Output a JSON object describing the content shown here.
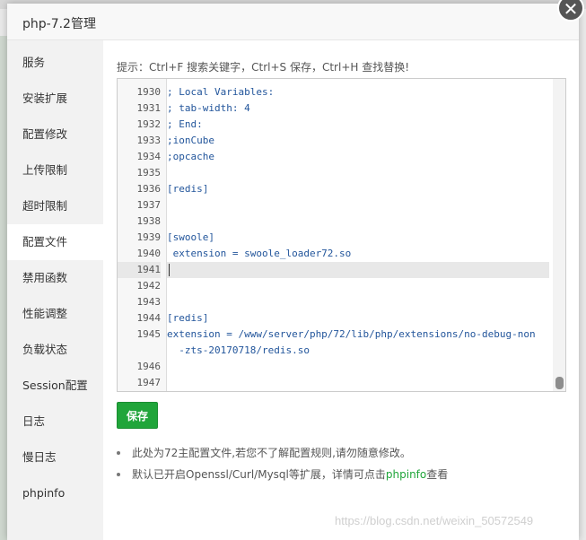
{
  "dialog": {
    "title": "php-7.2管理",
    "close_glyph": "✕"
  },
  "sidebar": {
    "items": [
      {
        "label": "服务"
      },
      {
        "label": "安装扩展"
      },
      {
        "label": "配置修改"
      },
      {
        "label": "上传限制"
      },
      {
        "label": "超时限制"
      },
      {
        "label": "配置文件"
      },
      {
        "label": "禁用函数"
      },
      {
        "label": "性能调整"
      },
      {
        "label": "负载状态"
      },
      {
        "label": "Session配置"
      },
      {
        "label": "日志"
      },
      {
        "label": "慢日志"
      },
      {
        "label": "phpinfo"
      }
    ],
    "active_index": 5
  },
  "content": {
    "tip": "提示：Ctrl+F 搜索关键字，Ctrl+S 保存，Ctrl+H 查找替换!",
    "editor": {
      "lines": [
        {
          "num": "1930",
          "text": "; Local Variables:"
        },
        {
          "num": "1931",
          "text": "; tab-width: 4"
        },
        {
          "num": "1932",
          "text": "; End:"
        },
        {
          "num": "1933",
          "text": ";ionCube"
        },
        {
          "num": "1934",
          "text": ";opcache"
        },
        {
          "num": "1935",
          "text": ""
        },
        {
          "num": "1936",
          "text": "[redis]"
        },
        {
          "num": "1937",
          "text": ""
        },
        {
          "num": "1938",
          "text": ""
        },
        {
          "num": "1939",
          "text": "[swoole]"
        },
        {
          "num": "1940",
          "text": " extension = swoole_loader72.so"
        },
        {
          "num": "1941",
          "text": ""
        },
        {
          "num": "1942",
          "text": ""
        },
        {
          "num": "1943",
          "text": ""
        },
        {
          "num": "1944",
          "text": "[redis]"
        },
        {
          "num": "1945",
          "text": "extension = /www/server/php/72/lib/php/extensions/no-debug-non"
        },
        {
          "num": "",
          "text": "  -zts-20170718/redis.so"
        },
        {
          "num": "1946",
          "text": ""
        },
        {
          "num": "1947",
          "text": ""
        }
      ],
      "active_line": "1941"
    },
    "save_label": "保存",
    "notes": {
      "note1": "此处为72主配置文件,若您不了解配置规则,请勿随意修改。",
      "note2_prefix": "默认已开启Openssl/Curl/Mysql等扩展，详情可点击",
      "note2_link": "phpinfo",
      "note2_suffix": "查看"
    }
  },
  "watermark": "https://blog.csdn.net/weixin_50572549",
  "colors": {
    "accent": "#20a53a",
    "code": "#22559b"
  }
}
